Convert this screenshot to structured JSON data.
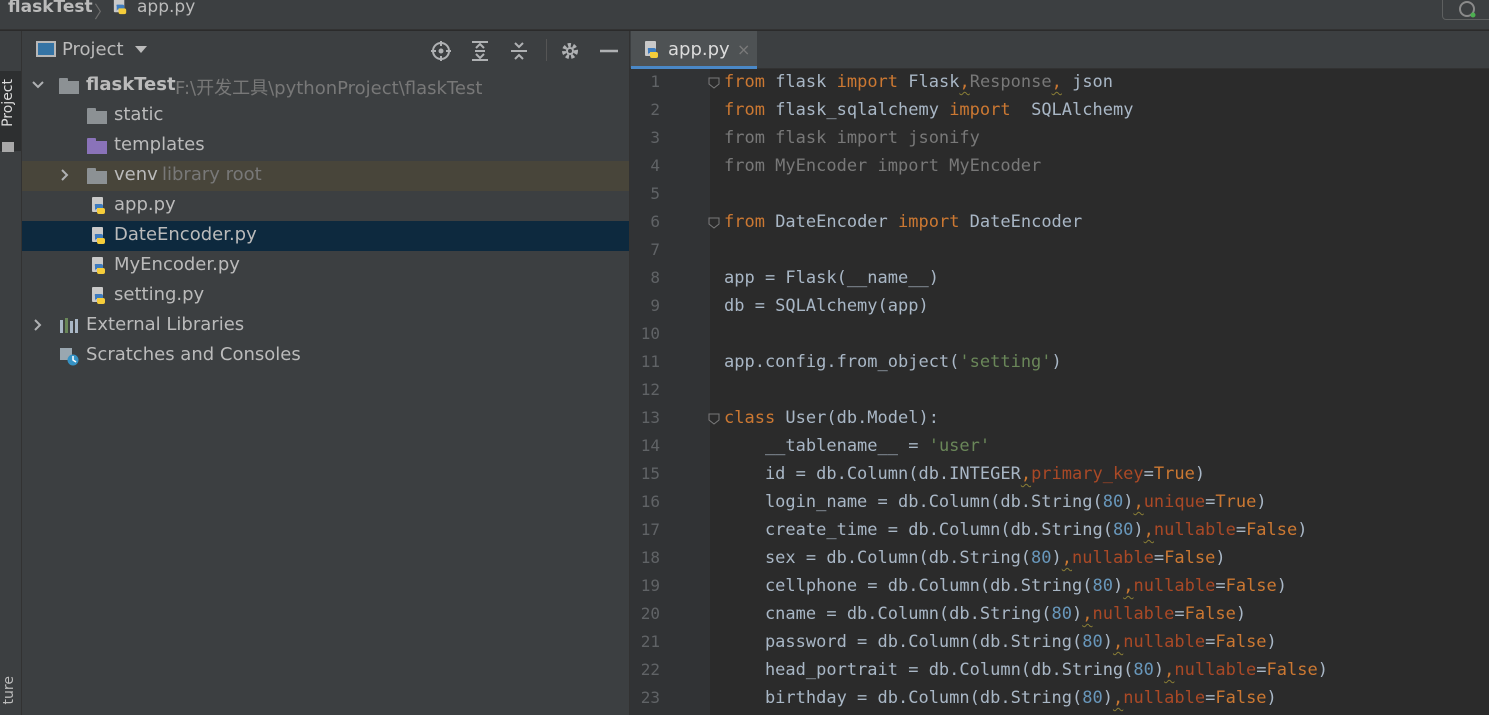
{
  "breadcrumb": {
    "project": "flaskTest",
    "separator": "〉",
    "file": "app.py"
  },
  "stripe": {
    "project_label": "Project",
    "structure_label": "ture"
  },
  "project_panel": {
    "title": "Project",
    "header_buttons": [
      "locate-icon",
      "expand-all-icon",
      "collapse-all-icon",
      "gear-icon",
      "minimize-icon"
    ],
    "tree": {
      "root_name": "flaskTest",
      "root_path": "F:\\开发工具\\pythonProject\\flaskTest",
      "items": [
        {
          "label": "static"
        },
        {
          "label": "templates"
        },
        {
          "label": "venv",
          "hint": "library root"
        },
        {
          "label": "app.py"
        },
        {
          "label": "DateEncoder.py"
        },
        {
          "label": "MyEncoder.py"
        },
        {
          "label": "setting.py"
        },
        {
          "label": "External Libraries"
        },
        {
          "label": "Scratches and Consoles"
        }
      ]
    }
  },
  "editor": {
    "tab": {
      "label": "app.py",
      "close": "×"
    },
    "line_numbers": [
      "1",
      "2",
      "3",
      "4",
      "5",
      "6",
      "7",
      "8",
      "9",
      "10",
      "11",
      "12",
      "13",
      "14",
      "15",
      "16",
      "17",
      "18",
      "19",
      "20",
      "21",
      "22",
      "23"
    ],
    "lines": [
      "from flask import Flask,Response, json",
      "from flask_sqlalchemy import  SQLAlchemy",
      "from flask import jsonify",
      "from MyEncoder import MyEncoder",
      "",
      "from DateEncoder import DateEncoder",
      "",
      "app = Flask(__name__)",
      "db = SQLAlchemy(app)",
      "",
      "app.config.from_object('setting')",
      "",
      "class User(db.Model):",
      "    __tablename__ = 'user'",
      "    id = db.Column(db.INTEGER,primary_key=True)",
      "    login_name = db.Column(db.String(80),unique=True)",
      "    create_time = db.Column(db.String(80),nullable=False)",
      "    sex = db.Column(db.String(80),nullable=False)",
      "    cellphone = db.Column(db.String(80),nullable=False)",
      "    cname = db.Column(db.String(80),nullable=False)",
      "    password = db.Column(db.String(80),nullable=False)",
      "    head_portrait = db.Column(db.String(80),nullable=False)",
      "    birthday = db.Column(db.String(80),nullable=False)"
    ]
  },
  "colors": {
    "keyword": "#cc7832",
    "string": "#6a8759",
    "number": "#6897bb",
    "param": "#aa4926",
    "identifier": "#a9b7c6",
    "unused": "#787878",
    "selection": "#0d293e",
    "library_root_row": "#48453a",
    "tab_underline": "#4a88c7"
  }
}
